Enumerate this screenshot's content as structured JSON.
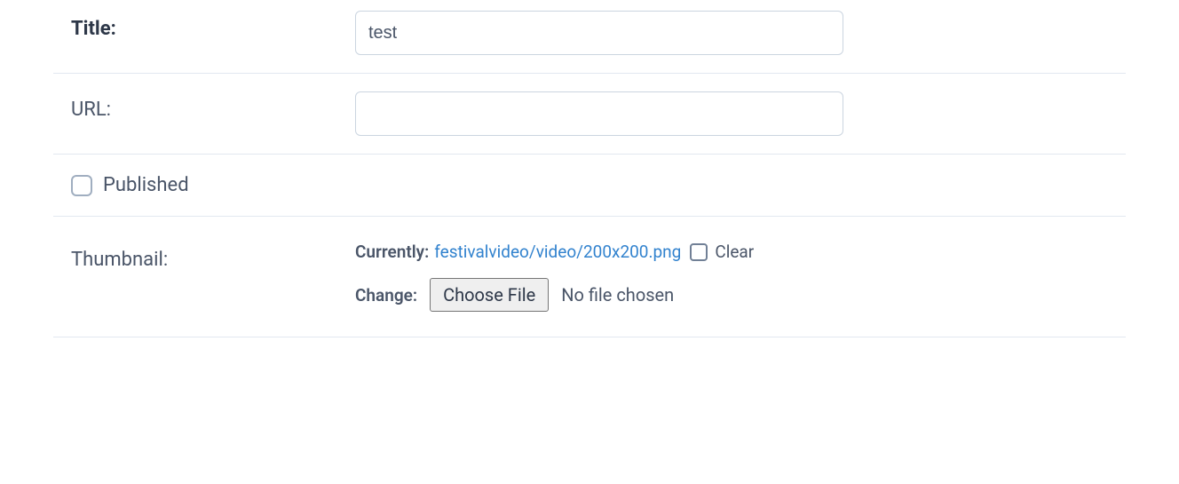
{
  "fields": {
    "title": {
      "label": "Title:",
      "value": "test"
    },
    "url": {
      "label": "URL:",
      "value": ""
    },
    "published": {
      "label": "Published",
      "checked": false
    },
    "thumbnail": {
      "label": "Thumbnail:",
      "currently_label": "Currently:",
      "current_file": "festivalvideo/video/200x200.png",
      "clear_label": "Clear",
      "change_label": "Change:",
      "choose_file_label": "Choose File",
      "no_file_text": "No file chosen"
    }
  }
}
